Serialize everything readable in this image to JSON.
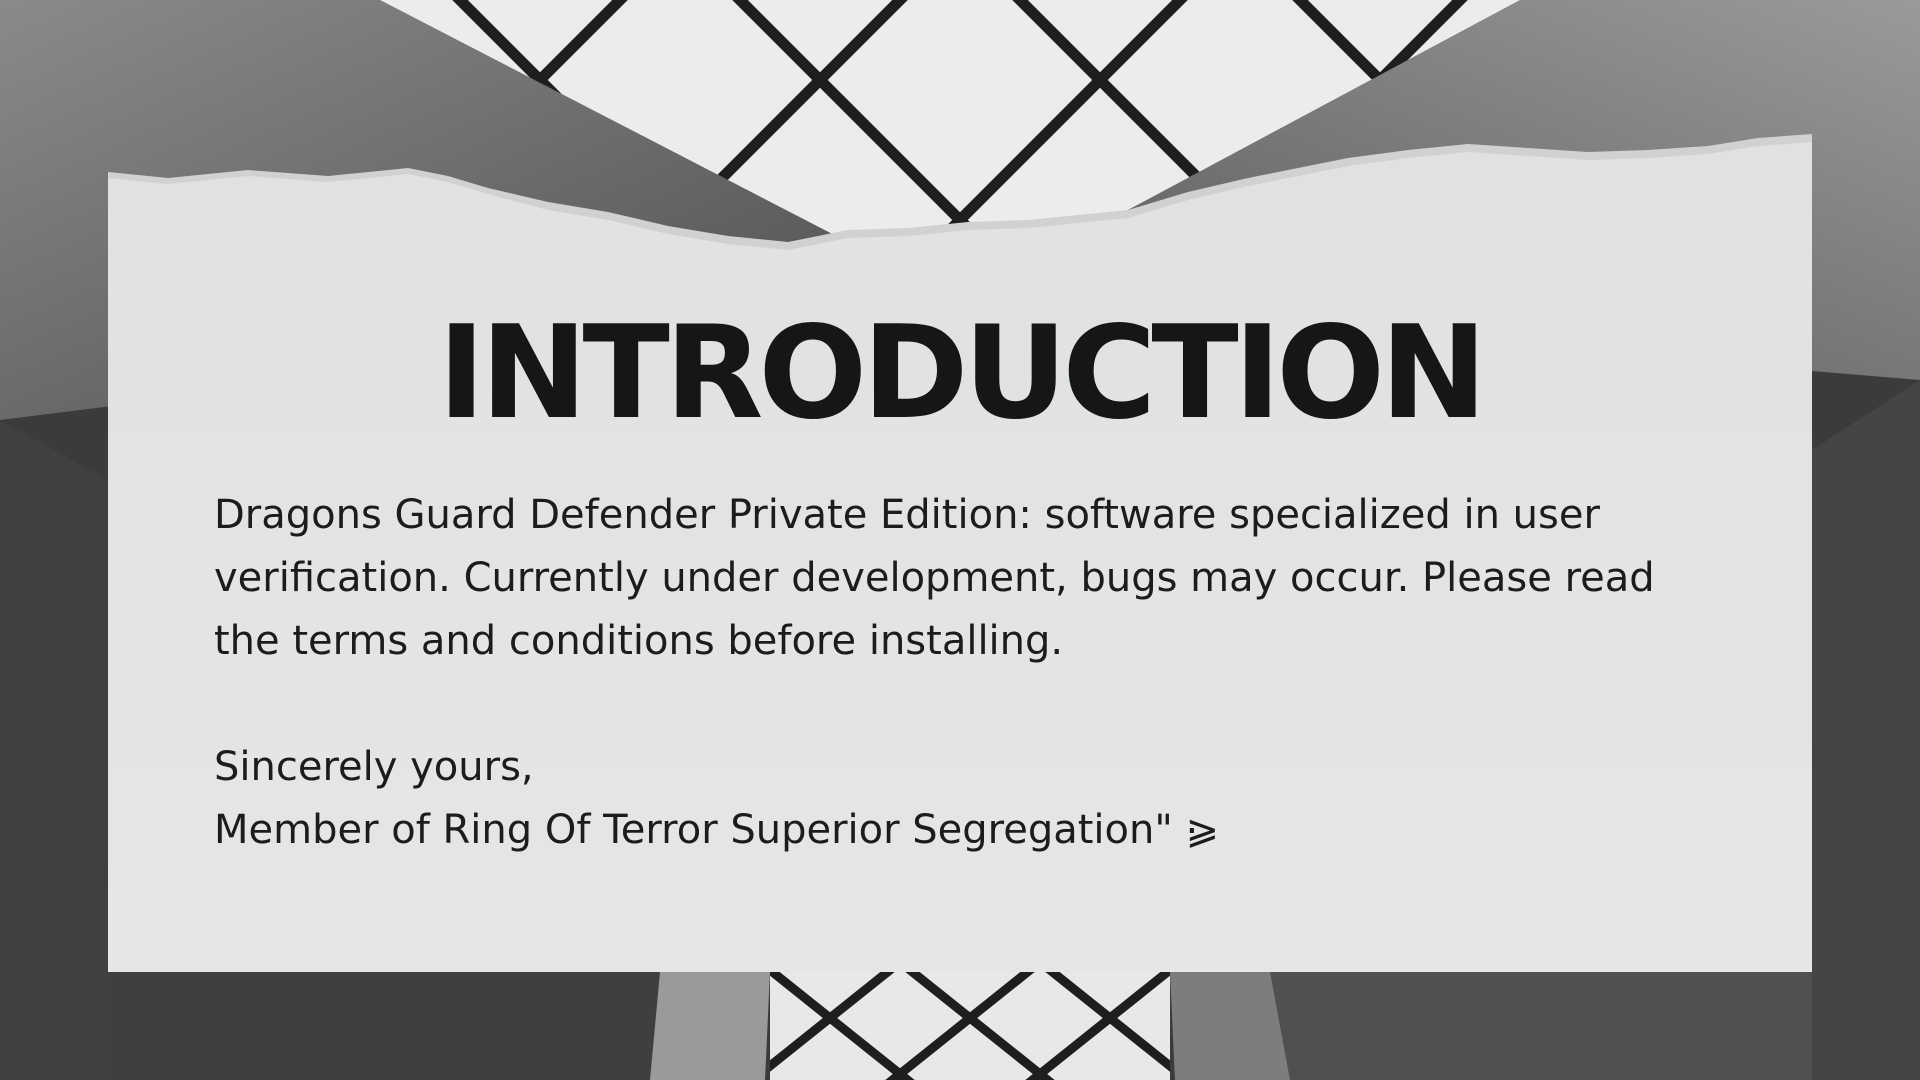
{
  "slide": {
    "title": "INTRODUCTION",
    "body": "Dragons Guard Defender Private Edition: software specialized in user verification. Currently under development, bugs may occur. Please read the terms and conditions before installing.",
    "closing": "Sincerely yours,",
    "signature": "Member of Ring Of Terror Superior Segregation\" ⪀"
  },
  "colors": {
    "paper": "#e3e5e7",
    "text": "#1c1c1c",
    "title": "#151717",
    "background_dark": "#3a3a3a",
    "ceiling_light": "#eeeeee",
    "grid_lines": "#1e1e1e"
  }
}
